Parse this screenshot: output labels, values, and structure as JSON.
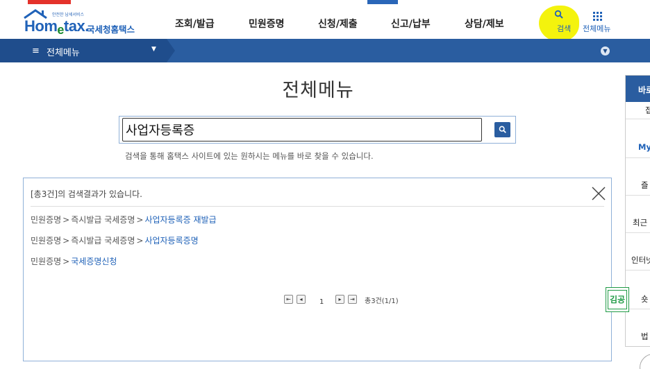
{
  "header": {
    "logo_small": "안전한 납세서비스",
    "logo_main_a": "Hom",
    "logo_main_e": "e",
    "logo_main_b": "tax.",
    "logo_kor": "국세청홈택스",
    "nav": [
      "조회/발급",
      "민원증명",
      "신청/제출",
      "신고/납부",
      "상담/제보"
    ],
    "search_label": "검색",
    "allmenu_label": "전체메뉴"
  },
  "subnav": {
    "title": "전체메뉴"
  },
  "page": {
    "title": "전체메뉴",
    "search_value": "사업자등록증",
    "hint": "검색을 통해 홈택스 사이트에 있는 원하시는 메뉴를 바로 찾을 수 있습니다."
  },
  "results": {
    "count_text": "[총3건]의 검색결과가 있습니다.",
    "rows": [
      {
        "path": [
          "민원증명",
          "즉시발급 국세증명"
        ],
        "target": "사업자등록증 재발급"
      },
      {
        "path": [
          "민원증명",
          "즉시발급 국세증명"
        ],
        "target": "사업자등록증명"
      },
      {
        "path": [
          "민원증명"
        ],
        "target": "국세증명신청"
      }
    ],
    "current_page": "1",
    "total_text": "총3건(1/1)"
  },
  "right_sidebar": {
    "head": "바로",
    "items": [
      "접",
      "My",
      "즐",
      "최근",
      "인터넷",
      "숏",
      "법"
    ]
  },
  "stamp": {
    "text": "김공"
  },
  "colors": {
    "brand_blue": "#2062b8",
    "nav_bar": "#2a5da0",
    "highlight": "#f3f200",
    "stamp_green": "#1e9a44"
  }
}
